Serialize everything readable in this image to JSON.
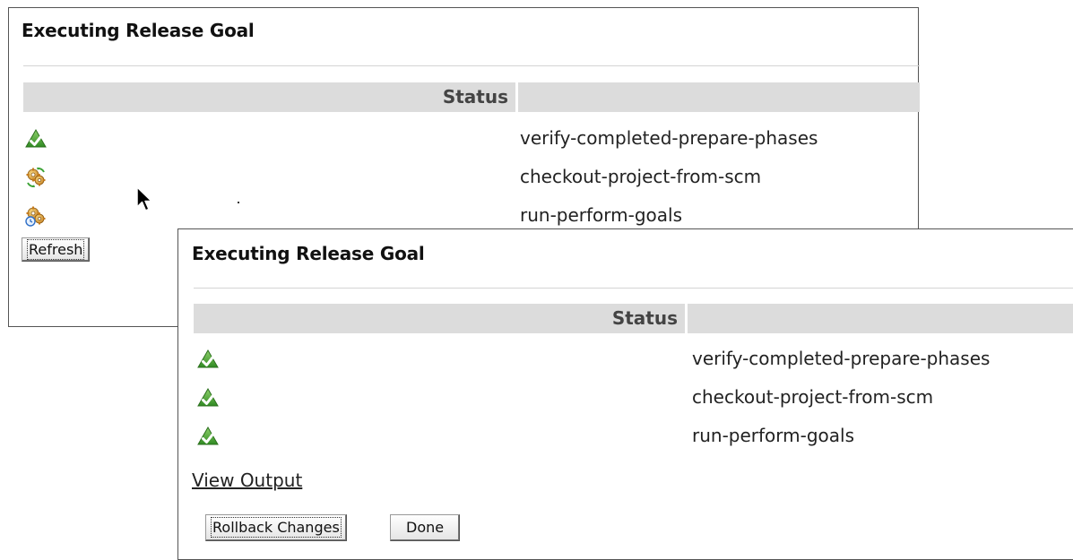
{
  "back_panel": {
    "title": "Executing Release Goal",
    "status_header": "Status",
    "rows": [
      {
        "icon": "success-check-icon",
        "step": "verify-completed-prepare-phases"
      },
      {
        "icon": "in-progress-gears-icon",
        "step": "checkout-project-from-scm"
      },
      {
        "icon": "pending-gears-clock-icon",
        "step": "run-perform-goals"
      }
    ],
    "refresh_label": "Refresh"
  },
  "front_panel": {
    "title": "Executing Release Goal",
    "status_header": "Status",
    "rows": [
      {
        "icon": "success-check-icon",
        "step": "verify-completed-prepare-phases"
      },
      {
        "icon": "success-check-icon",
        "step": "checkout-project-from-scm"
      },
      {
        "icon": "success-check-icon",
        "step": "run-perform-goals"
      }
    ],
    "view_output_label": "View Output",
    "rollback_label": "Rollback Changes",
    "done_label": "Done"
  },
  "colors": {
    "header_bg": "#dcdcdc",
    "success_green": "#3f9a2e",
    "gear_orange": "#d9912e",
    "clock_blue": "#2f6fc7"
  }
}
